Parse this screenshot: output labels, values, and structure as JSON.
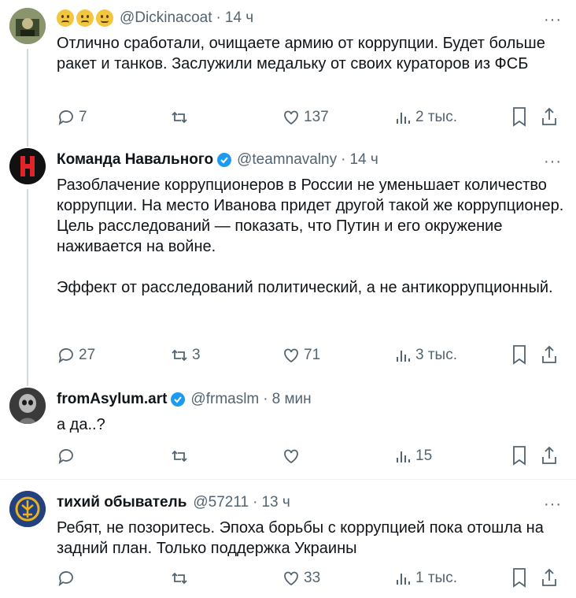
{
  "colors": {
    "accent": "#1d9bf0",
    "muted": "#536471",
    "text": "#0f1419"
  },
  "tweets": [
    {
      "name": "",
      "handle": "@Dickinacoat",
      "time": "14 ч",
      "emoji_icons": [
        "worried-face-icon",
        "confused-face-icon",
        "upside-down-face-icon"
      ],
      "text": "Отлично сработали, очищаете армию от коррупции. Будет больше ракет и танков. Заслужили медальку от своих кураторов из ФСБ",
      "replies": "7",
      "retweets": "",
      "likes": "137",
      "views": "2 тыс."
    },
    {
      "name": "Команда Навального",
      "verified": true,
      "handle": "@teamnavalny",
      "time": "14 ч",
      "text": "Разоблачение коррупционеров в России не уменьшает количество коррупции. На место Иванова придет другой такой же коррупционер. Цель расследований — показать, что Путин и его окружение наживается на войне.\n\nЭффект от расследований политический, а не антикоррупционный.",
      "replies": "27",
      "retweets": "3",
      "likes": "71",
      "views": "3 тыс."
    },
    {
      "name": "fromAsylum.art",
      "verified": true,
      "handle": "@frmaslm",
      "time": "8 мин",
      "text": "а да..?",
      "replies": "",
      "retweets": "",
      "likes": "",
      "views": "15"
    },
    {
      "name": "тихий обыватель",
      "verified": false,
      "handle": "@57211",
      "time": "13 ч",
      "text": "Ребят, не позоритесь. Эпоха борьбы с коррупцией пока отошла на задний план. Только поддержка Украины",
      "replies": "",
      "retweets": "",
      "likes": "33",
      "views": "1 тыс."
    }
  ],
  "more_label": "···",
  "dot": "·"
}
